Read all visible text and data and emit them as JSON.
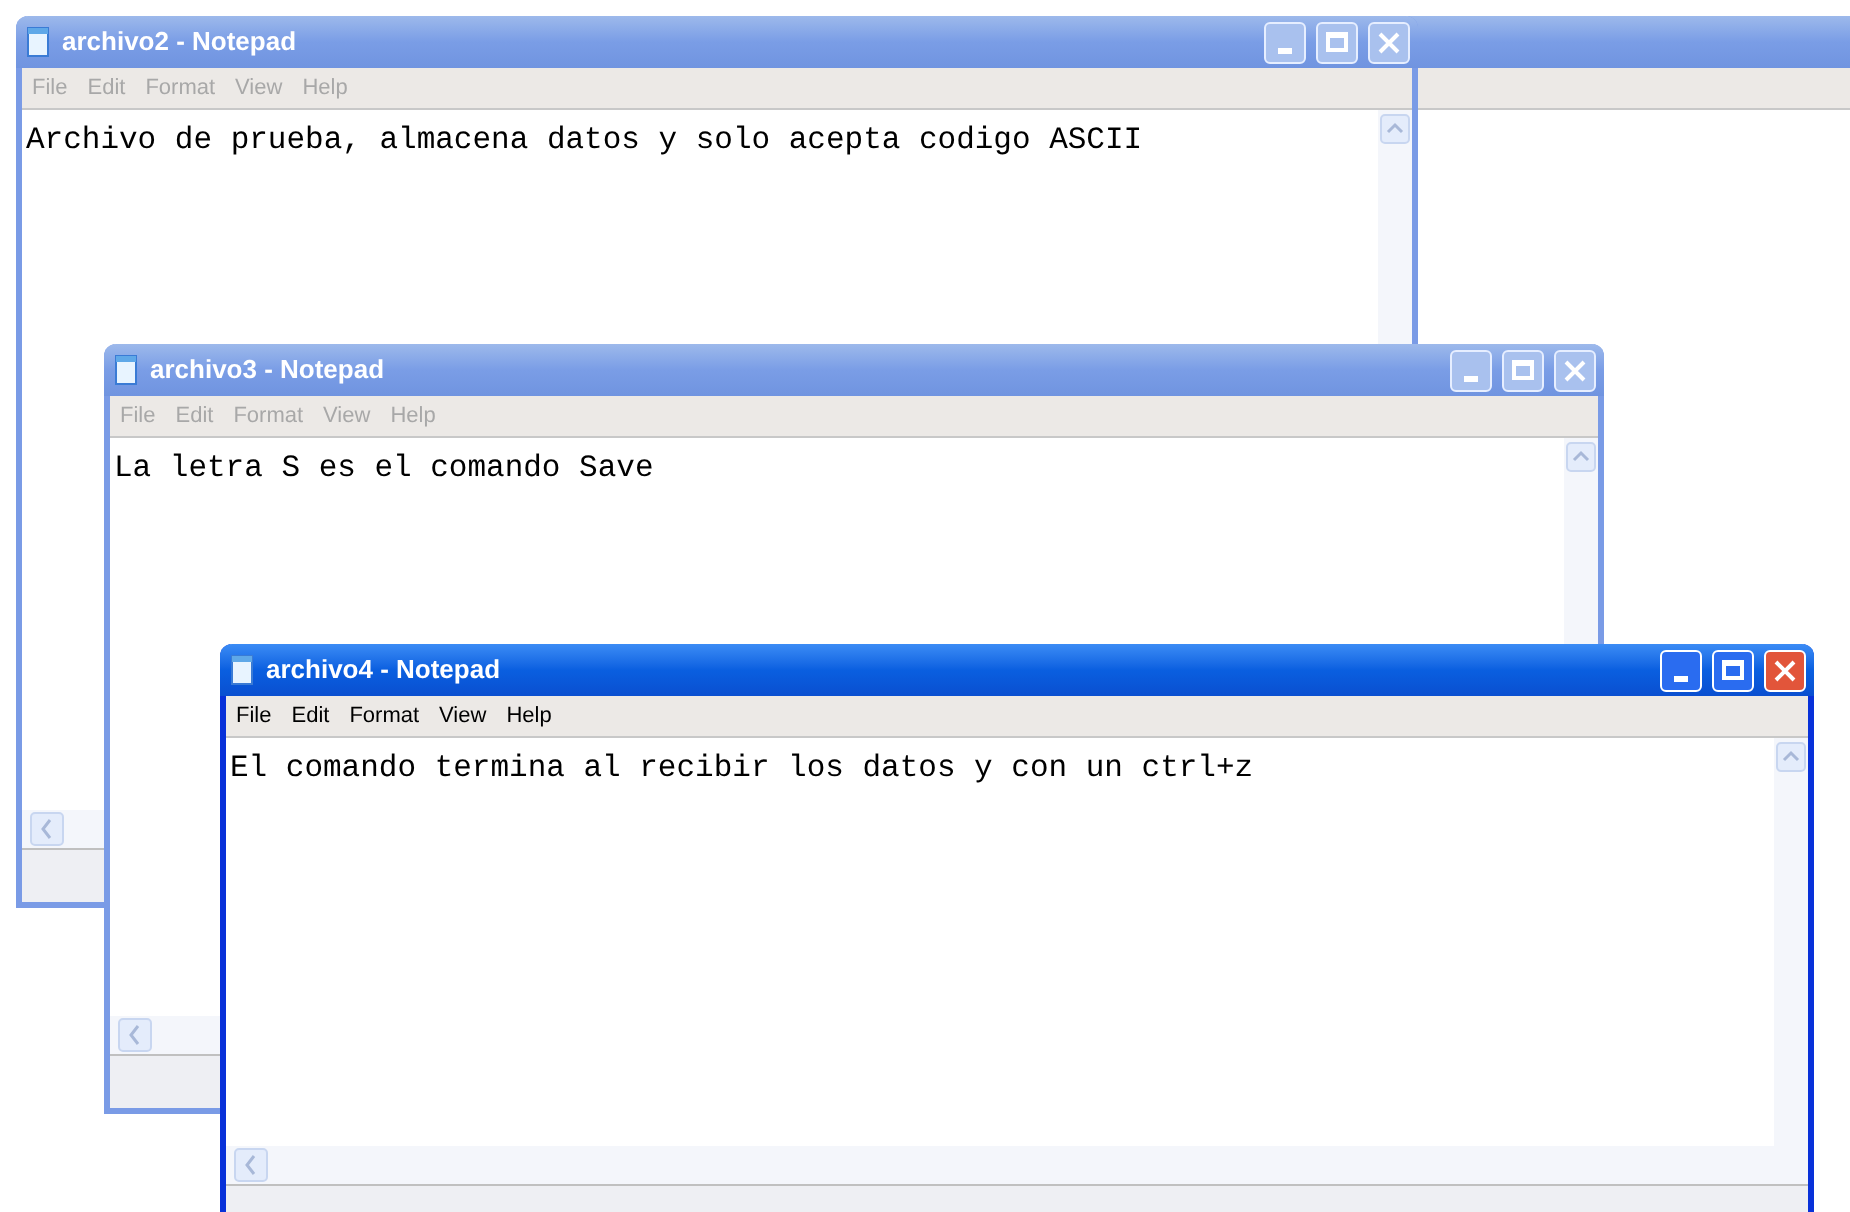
{
  "windows": [
    {
      "title": "archivo2 - Notepad",
      "active": false,
      "menu": [
        "File",
        "Edit",
        "Format",
        "View",
        "Help"
      ],
      "text": "Archivo de prueba, almacena datos y solo acepta codigo ASCII"
    },
    {
      "title": "archivo3 - Notepad",
      "active": false,
      "menu": [
        "File",
        "Edit",
        "Format",
        "View",
        "Help"
      ],
      "text": "La letra S es el comando Save"
    },
    {
      "title": "archivo4 - Notepad",
      "active": true,
      "menu": [
        "File",
        "Edit",
        "Format",
        "View",
        "Help"
      ],
      "text": "El comando termina al recibir los datos y con un ctrl+z"
    }
  ]
}
